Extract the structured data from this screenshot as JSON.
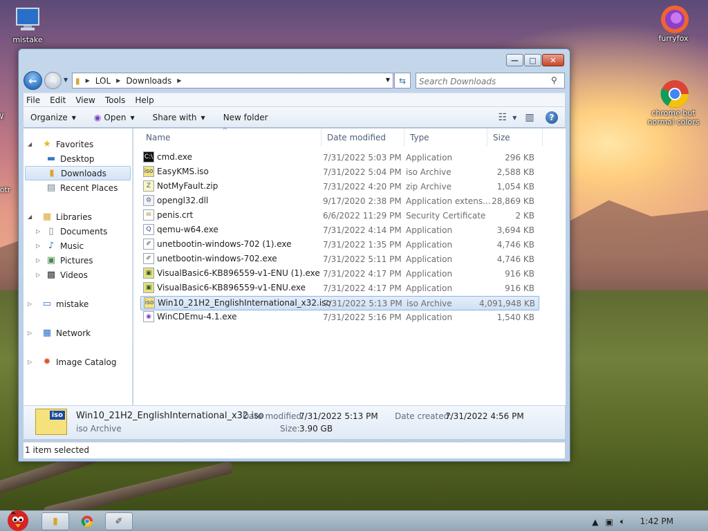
{
  "desktop": {
    "icons": [
      {
        "label": "mistake"
      },
      {
        "label": "furryfox"
      },
      {
        "label": "chrome but normal colors"
      }
    ],
    "partial_labels": [
      "W",
      "notr"
    ]
  },
  "window": {
    "address": {
      "parts": [
        "LOL",
        "Downloads"
      ]
    },
    "search_placeholder": "Search Downloads",
    "menu": [
      "File",
      "Edit",
      "View",
      "Tools",
      "Help"
    ],
    "toolbar": {
      "organize": "Organize",
      "open": "Open",
      "share": "Share with",
      "new_folder": "New folder"
    },
    "nav": {
      "favorites": "Favorites",
      "desktop": "Desktop",
      "downloads": "Downloads",
      "recent": "Recent Places",
      "libraries": "Libraries",
      "documents": "Documents",
      "music": "Music",
      "pictures": "Pictures",
      "videos": "Videos",
      "computer": "mistake",
      "network": "Network",
      "image_catalog": "Image Catalog"
    },
    "columns": {
      "name": "Name",
      "date": "Date modified",
      "type": "Type",
      "size": "Size"
    },
    "files": [
      {
        "name": "cmd.exe",
        "date": "7/31/2022 5:03 PM",
        "type": "Application",
        "size": "296 KB",
        "icon": "console-icon"
      },
      {
        "name": "EasyKMS.iso",
        "date": "7/31/2022 5:04 PM",
        "type": "iso Archive",
        "size": "2,588 KB",
        "icon": "iso-icon"
      },
      {
        "name": "NotMyFault.zip",
        "date": "7/31/2022 4:20 PM",
        "type": "zip Archive",
        "size": "1,054 KB",
        "icon": "zip-icon"
      },
      {
        "name": "opengl32.dll",
        "date": "9/17/2020 2:38 PM",
        "type": "Application extens...",
        "size": "28,869 KB",
        "icon": "dll-icon"
      },
      {
        "name": "penis.crt",
        "date": "6/6/2022 11:29 PM",
        "type": "Security Certificate",
        "size": "2 KB",
        "icon": "certificate-icon"
      },
      {
        "name": "qemu-w64.exe",
        "date": "7/31/2022 4:14 PM",
        "type": "Application",
        "size": "3,694 KB",
        "icon": "qemu-icon"
      },
      {
        "name": "unetbootin-windows-702 (1).exe",
        "date": "7/31/2022 1:35 PM",
        "type": "Application",
        "size": "4,746 KB",
        "icon": "unetbootin-icon"
      },
      {
        "name": "unetbootin-windows-702.exe",
        "date": "7/31/2022 5:11 PM",
        "type": "Application",
        "size": "4,746 KB",
        "icon": "unetbootin-icon"
      },
      {
        "name": "VisualBasic6-KB896559-v1-ENU (1).exe",
        "date": "7/31/2022 4:17 PM",
        "type": "Application",
        "size": "916 KB",
        "icon": "installer-icon"
      },
      {
        "name": "VisualBasic6-KB896559-v1-ENU.exe",
        "date": "7/31/2022 4:17 PM",
        "type": "Application",
        "size": "916 KB",
        "icon": "installer-icon"
      },
      {
        "name": "Win10_21H2_EnglishInternational_x32.iso",
        "date": "7/31/2022 5:13 PM",
        "type": "iso Archive",
        "size": "4,091,948 KB",
        "icon": "iso-icon",
        "selected": true
      },
      {
        "name": "WinCDEmu-4.1.exe",
        "date": "7/31/2022 5:16 PM",
        "type": "Application",
        "size": "1,540 KB",
        "icon": "wincdemu-icon"
      }
    ],
    "details": {
      "filename": "Win10_21H2_EnglishInternational_x32.iso",
      "filetype": "iso Archive",
      "date_modified_label": "Date modified:",
      "date_modified": "7/31/2022 5:13 PM",
      "date_created_label": "Date created:",
      "date_created": "7/31/2022 4:56 PM",
      "size_label": "Size:",
      "size": "3.90 GB",
      "icon_text": "iso"
    },
    "status": "1 item selected"
  },
  "taskbar": {
    "clock": "1:42 PM"
  }
}
